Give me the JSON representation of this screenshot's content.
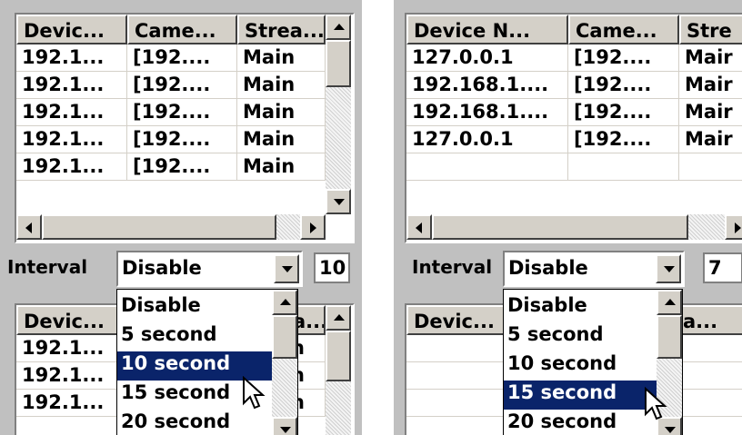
{
  "left": {
    "top_grid": {
      "headers": [
        "Devic...",
        "Came...",
        "Strea..."
      ],
      "rows": [
        [
          "192.1...",
          "[192....",
          "Main"
        ],
        [
          "192.1...",
          "[192....",
          "Main"
        ],
        [
          "192.1...",
          "[192....",
          "Main"
        ],
        [
          "192.1...",
          "[192....",
          "Main"
        ],
        [
          "192.1...",
          "[192....",
          "Main"
        ]
      ]
    },
    "interval_label": "Interval",
    "combo_value": "Disable",
    "count_value": "10",
    "dropdown_options": [
      "Disable",
      "5 second",
      "10 second",
      "15 second",
      "20 second"
    ],
    "selected_option": "10 second",
    "bottom_grid": {
      "headers": [
        "Devic...",
        "a..."
      ],
      "rows": [
        [
          "192.1...",
          "n"
        ],
        [
          "192.1...",
          "n"
        ],
        [
          "192.1...",
          "n"
        ]
      ]
    }
  },
  "right": {
    "top_grid": {
      "headers": [
        "Device N...",
        "Came...",
        "Stre"
      ],
      "rows": [
        [
          "127.0.0.1",
          "[192....",
          "Mair"
        ],
        [
          "192.168.1....",
          "[192....",
          "Mair"
        ],
        [
          "192.168.1....",
          "[192....",
          "Mair"
        ],
        [
          "127.0.0.1",
          "[192....",
          "Mair"
        ],
        [
          "",
          "",
          ""
        ]
      ]
    },
    "interval_label": "Interval",
    "combo_value": "Disable",
    "count_value": "7",
    "dropdown_options": [
      "Disable",
      "5 second",
      "10 second",
      "15 second",
      "20 second"
    ],
    "selected_option": "15 second",
    "bottom_grid": {
      "headers": [
        "Devic...",
        "a..."
      ],
      "rows": [
        [
          "",
          ""
        ],
        [
          "",
          ""
        ],
        [
          "",
          ""
        ]
      ]
    }
  },
  "colors": {
    "selection": "#0a246a",
    "face": "#c0c0c0"
  }
}
